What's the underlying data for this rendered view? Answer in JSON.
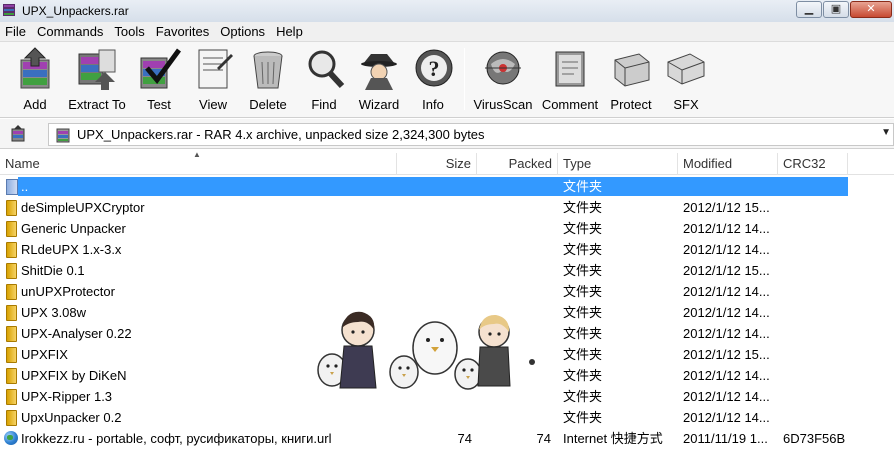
{
  "window": {
    "title": "UPX_Unpackers.rar"
  },
  "menu": [
    "File",
    "Commands",
    "Tools",
    "Favorites",
    "Options",
    "Help"
  ],
  "toolbar": {
    "buttons": [
      {
        "label": "Add",
        "icon": "add-archive-icon"
      },
      {
        "label": "Extract To",
        "icon": "extract-to-icon"
      },
      {
        "label": "Test",
        "icon": "test-checkmark-icon"
      },
      {
        "label": "View",
        "icon": "view-document-icon"
      },
      {
        "label": "Delete",
        "icon": "trash-can-icon"
      },
      {
        "label": "Find",
        "icon": "magnifier-icon"
      },
      {
        "label": "Wizard",
        "icon": "wizard-icon"
      },
      {
        "label": "Info",
        "icon": "info-icon"
      },
      {
        "label": "VirusScan",
        "icon": "virus-scan-icon"
      },
      {
        "label": "Comment",
        "icon": "comment-book-icon"
      },
      {
        "label": "Protect",
        "icon": "protect-icon"
      },
      {
        "label": "SFX",
        "icon": "sfx-box-icon"
      }
    ]
  },
  "address": {
    "text": "UPX_Unpackers.rar - RAR 4.x archive, unpacked size 2,324,300 bytes"
  },
  "columns": {
    "name": "Name",
    "size": "Size",
    "packed": "Packed",
    "type": "Type",
    "modified": "Modified",
    "crc": "CRC32"
  },
  "files": [
    {
      "name": "..",
      "size": "",
      "packed": "",
      "type": "文件夹",
      "modified": "",
      "crc": "",
      "icon": "folder-up-icon",
      "selected": true
    },
    {
      "name": "deSimpleUPXCryptor",
      "size": "",
      "packed": "",
      "type": "文件夹",
      "modified": "2012/1/12 15...",
      "crc": "",
      "icon": "folder-icon"
    },
    {
      "name": "Generic Unpacker",
      "size": "",
      "packed": "",
      "type": "文件夹",
      "modified": "2012/1/12 14...",
      "crc": "",
      "icon": "folder-icon"
    },
    {
      "name": "RLdeUPX 1.x-3.x",
      "size": "",
      "packed": "",
      "type": "文件夹",
      "modified": "2012/1/12 14...",
      "crc": "",
      "icon": "folder-icon"
    },
    {
      "name": "ShitDie 0.1",
      "size": "",
      "packed": "",
      "type": "文件夹",
      "modified": "2012/1/12 15...",
      "crc": "",
      "icon": "folder-icon"
    },
    {
      "name": "unUPXProtector",
      "size": "",
      "packed": "",
      "type": "文件夹",
      "modified": "2012/1/12 14...",
      "crc": "",
      "icon": "folder-icon"
    },
    {
      "name": "UPX 3.08w",
      "size": "",
      "packed": "",
      "type": "文件夹",
      "modified": "2012/1/12 14...",
      "crc": "",
      "icon": "folder-icon"
    },
    {
      "name": "UPX-Analyser 0.22",
      "size": "",
      "packed": "",
      "type": "文件夹",
      "modified": "2012/1/12 14...",
      "crc": "",
      "icon": "folder-icon"
    },
    {
      "name": "UPXFIX",
      "size": "",
      "packed": "",
      "type": "文件夹",
      "modified": "2012/1/12 15...",
      "crc": "",
      "icon": "folder-icon"
    },
    {
      "name": "UPXFIX by DiKeN",
      "size": "",
      "packed": "",
      "type": "文件夹",
      "modified": "2012/1/12 14...",
      "crc": "",
      "icon": "folder-icon"
    },
    {
      "name": "UPX-Ripper 1.3",
      "size": "",
      "packed": "",
      "type": "文件夹",
      "modified": "2012/1/12 14...",
      "crc": "",
      "icon": "folder-icon"
    },
    {
      "name": "UpxUnpacker 0.2",
      "size": "",
      "packed": "",
      "type": "文件夹",
      "modified": "2012/1/12 14...",
      "crc": "",
      "icon": "folder-icon"
    },
    {
      "name": "Irokkezz.ru - portable, софт, русификаторы, книги.url",
      "size": "74",
      "packed": "74",
      "type": "Internet 快捷方式",
      "modified": "2011/11/19 1...",
      "crc": "6D73F56B",
      "icon": "globe-icon"
    }
  ],
  "colors": {
    "selection": "#3399ff",
    "folder": "#f0c040"
  }
}
